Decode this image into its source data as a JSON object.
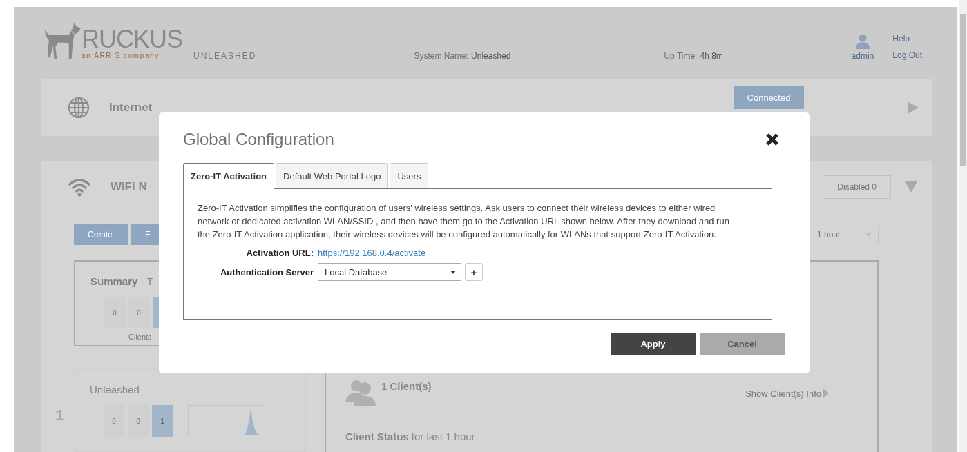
{
  "header": {
    "logo_text": "RUCKUS",
    "logo_tagline": "an ARRIS company",
    "product": "UNLEASHED",
    "system_name_label": "System Name:",
    "system_name": "Unleashed",
    "uptime_label": "Up Time:",
    "uptime": "4h 8m",
    "user": "admin",
    "links": [
      "Help",
      "Log Out"
    ]
  },
  "internet": {
    "title": "Internet",
    "status": "Connected"
  },
  "wifi": {
    "title": "WiFi N",
    "badge": "Disabled 0",
    "buttons": [
      "Create",
      "E"
    ],
    "time_range": "1 hour",
    "summary": {
      "title": "**Summary** - T",
      "counts": [
        "0",
        "0"
      ],
      "counts_label": "Clients"
    },
    "ap": {
      "index": "1",
      "name": "Unleashed",
      "counts": [
        "0",
        "0",
        "1"
      ]
    },
    "clients": {
      "count": "1 Client(s)",
      "link": "Show Client(s) Info",
      "status": "**Client Status** for last 1 hour"
    }
  },
  "modal": {
    "title": "Global Configuration",
    "tabs": [
      {
        "label": "Zero-IT Activation",
        "selected": true
      },
      {
        "label": "Default Web Portal Logo",
        "selected": false
      },
      {
        "label": "Users",
        "selected": false
      }
    ],
    "description": "Zero-IT Activation simplifies the configuration of users' wireless settings. Ask users to connect their wireless devices to either wired network or dedicated activation WLAN/SSID , and then have them go to the Activation URL shown below. After they download and run the Zero-IT Activation application, their wireless devices will be configured automatically for WLANs that support Zero-IT Activation.",
    "activation_url_label": "Activation URL:",
    "activation_url": "https://192.168.0.4/activate",
    "auth_label": "Authentication Server",
    "auth_value": "Local Database",
    "add_button": "+",
    "buttons": [
      {
        "label": "Apply",
        "kind": "primary"
      },
      {
        "label": "Cancel",
        "kind": "secondary"
      }
    ]
  }
}
